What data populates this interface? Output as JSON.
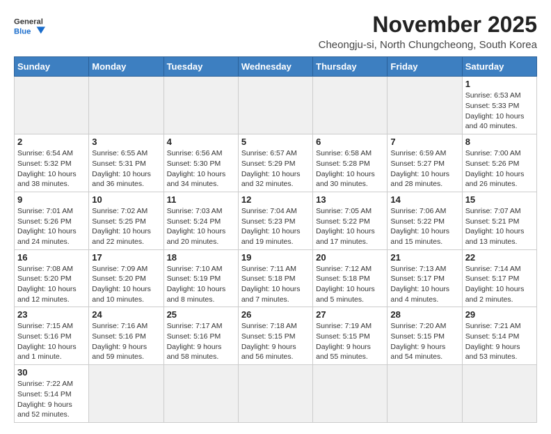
{
  "header": {
    "logo_general": "General",
    "logo_blue": "Blue",
    "title": "November 2025",
    "subtitle": "Cheongju-si, North Chungcheong, South Korea"
  },
  "weekdays": [
    "Sunday",
    "Monday",
    "Tuesday",
    "Wednesday",
    "Thursday",
    "Friday",
    "Saturday"
  ],
  "weeks": [
    [
      {
        "day": "",
        "info": ""
      },
      {
        "day": "",
        "info": ""
      },
      {
        "day": "",
        "info": ""
      },
      {
        "day": "",
        "info": ""
      },
      {
        "day": "",
        "info": ""
      },
      {
        "day": "",
        "info": ""
      },
      {
        "day": "1",
        "info": "Sunrise: 6:53 AM\nSunset: 5:33 PM\nDaylight: 10 hours and 40 minutes."
      }
    ],
    [
      {
        "day": "2",
        "info": "Sunrise: 6:54 AM\nSunset: 5:32 PM\nDaylight: 10 hours and 38 minutes."
      },
      {
        "day": "3",
        "info": "Sunrise: 6:55 AM\nSunset: 5:31 PM\nDaylight: 10 hours and 36 minutes."
      },
      {
        "day": "4",
        "info": "Sunrise: 6:56 AM\nSunset: 5:30 PM\nDaylight: 10 hours and 34 minutes."
      },
      {
        "day": "5",
        "info": "Sunrise: 6:57 AM\nSunset: 5:29 PM\nDaylight: 10 hours and 32 minutes."
      },
      {
        "day": "6",
        "info": "Sunrise: 6:58 AM\nSunset: 5:28 PM\nDaylight: 10 hours and 30 minutes."
      },
      {
        "day": "7",
        "info": "Sunrise: 6:59 AM\nSunset: 5:27 PM\nDaylight: 10 hours and 28 minutes."
      },
      {
        "day": "8",
        "info": "Sunrise: 7:00 AM\nSunset: 5:26 PM\nDaylight: 10 hours and 26 minutes."
      }
    ],
    [
      {
        "day": "9",
        "info": "Sunrise: 7:01 AM\nSunset: 5:26 PM\nDaylight: 10 hours and 24 minutes."
      },
      {
        "day": "10",
        "info": "Sunrise: 7:02 AM\nSunset: 5:25 PM\nDaylight: 10 hours and 22 minutes."
      },
      {
        "day": "11",
        "info": "Sunrise: 7:03 AM\nSunset: 5:24 PM\nDaylight: 10 hours and 20 minutes."
      },
      {
        "day": "12",
        "info": "Sunrise: 7:04 AM\nSunset: 5:23 PM\nDaylight: 10 hours and 19 minutes."
      },
      {
        "day": "13",
        "info": "Sunrise: 7:05 AM\nSunset: 5:22 PM\nDaylight: 10 hours and 17 minutes."
      },
      {
        "day": "14",
        "info": "Sunrise: 7:06 AM\nSunset: 5:22 PM\nDaylight: 10 hours and 15 minutes."
      },
      {
        "day": "15",
        "info": "Sunrise: 7:07 AM\nSunset: 5:21 PM\nDaylight: 10 hours and 13 minutes."
      }
    ],
    [
      {
        "day": "16",
        "info": "Sunrise: 7:08 AM\nSunset: 5:20 PM\nDaylight: 10 hours and 12 minutes."
      },
      {
        "day": "17",
        "info": "Sunrise: 7:09 AM\nSunset: 5:20 PM\nDaylight: 10 hours and 10 minutes."
      },
      {
        "day": "18",
        "info": "Sunrise: 7:10 AM\nSunset: 5:19 PM\nDaylight: 10 hours and 8 minutes."
      },
      {
        "day": "19",
        "info": "Sunrise: 7:11 AM\nSunset: 5:18 PM\nDaylight: 10 hours and 7 minutes."
      },
      {
        "day": "20",
        "info": "Sunrise: 7:12 AM\nSunset: 5:18 PM\nDaylight: 10 hours and 5 minutes."
      },
      {
        "day": "21",
        "info": "Sunrise: 7:13 AM\nSunset: 5:17 PM\nDaylight: 10 hours and 4 minutes."
      },
      {
        "day": "22",
        "info": "Sunrise: 7:14 AM\nSunset: 5:17 PM\nDaylight: 10 hours and 2 minutes."
      }
    ],
    [
      {
        "day": "23",
        "info": "Sunrise: 7:15 AM\nSunset: 5:16 PM\nDaylight: 10 hours and 1 minute."
      },
      {
        "day": "24",
        "info": "Sunrise: 7:16 AM\nSunset: 5:16 PM\nDaylight: 9 hours and 59 minutes."
      },
      {
        "day": "25",
        "info": "Sunrise: 7:17 AM\nSunset: 5:16 PM\nDaylight: 9 hours and 58 minutes."
      },
      {
        "day": "26",
        "info": "Sunrise: 7:18 AM\nSunset: 5:15 PM\nDaylight: 9 hours and 56 minutes."
      },
      {
        "day": "27",
        "info": "Sunrise: 7:19 AM\nSunset: 5:15 PM\nDaylight: 9 hours and 55 minutes."
      },
      {
        "day": "28",
        "info": "Sunrise: 7:20 AM\nSunset: 5:15 PM\nDaylight: 9 hours and 54 minutes."
      },
      {
        "day": "29",
        "info": "Sunrise: 7:21 AM\nSunset: 5:14 PM\nDaylight: 9 hours and 53 minutes."
      }
    ],
    [
      {
        "day": "30",
        "info": "Sunrise: 7:22 AM\nSunset: 5:14 PM\nDaylight: 9 hours and 52 minutes."
      },
      {
        "day": "",
        "info": ""
      },
      {
        "day": "",
        "info": ""
      },
      {
        "day": "",
        "info": ""
      },
      {
        "day": "",
        "info": ""
      },
      {
        "day": "",
        "info": ""
      },
      {
        "day": "",
        "info": ""
      }
    ]
  ]
}
